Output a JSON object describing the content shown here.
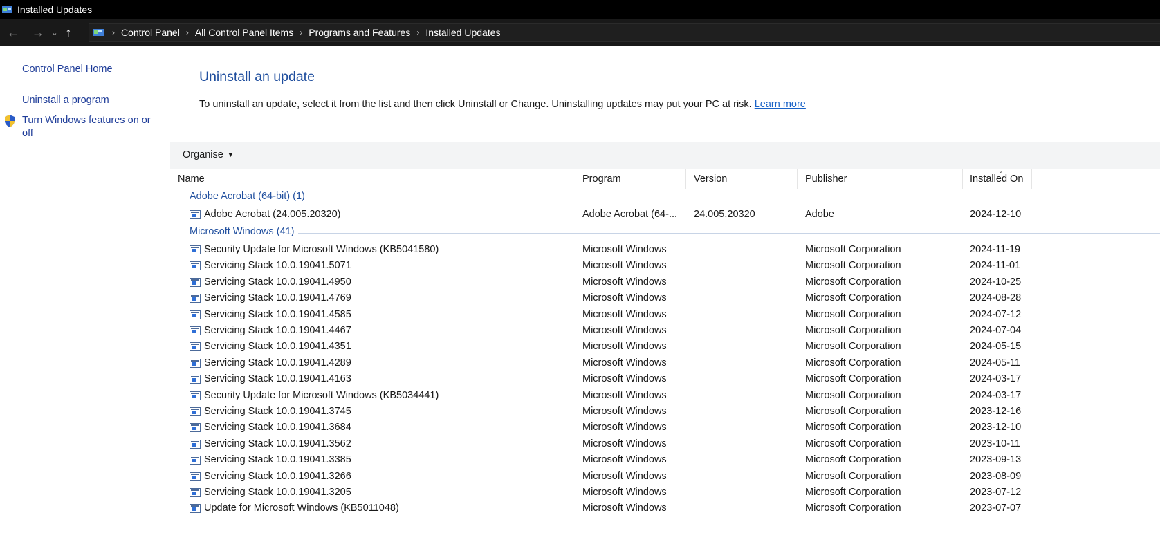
{
  "window": {
    "title": "Installed Updates"
  },
  "breadcrumbs": [
    "Control Panel",
    "All Control Panel Items",
    "Programs and Features",
    "Installed Updates"
  ],
  "sidebar": {
    "home": "Control Panel Home",
    "uninstall_program": "Uninstall a program",
    "windows_features": "Turn Windows features on or off"
  },
  "main": {
    "title": "Uninstall an update",
    "description": "To uninstall an update, select it from the list and then click Uninstall or Change. Uninstalling updates may put your PC at risk.",
    "learn_more": "Learn more",
    "organise": "Organise"
  },
  "columns": [
    "Name",
    "Program",
    "Version",
    "Publisher",
    "Installed On"
  ],
  "groups": [
    {
      "label": "Adobe Acrobat (64-bit) (1)",
      "rows": [
        {
          "name": "Adobe Acrobat (24.005.20320)",
          "program": "Adobe Acrobat (64-...",
          "version": "24.005.20320",
          "publisher": "Adobe",
          "date": "2024-12-10"
        }
      ]
    },
    {
      "label": "Microsoft Windows (41)",
      "rows": [
        {
          "name": "Security Update for Microsoft Windows (KB5041580)",
          "program": "Microsoft Windows",
          "version": "",
          "publisher": "Microsoft Corporation",
          "date": "2024-11-19"
        },
        {
          "name": "Servicing Stack 10.0.19041.5071",
          "program": "Microsoft Windows",
          "version": "",
          "publisher": "Microsoft Corporation",
          "date": "2024-11-01"
        },
        {
          "name": "Servicing Stack 10.0.19041.4950",
          "program": "Microsoft Windows",
          "version": "",
          "publisher": "Microsoft Corporation",
          "date": "2024-10-25"
        },
        {
          "name": "Servicing Stack 10.0.19041.4769",
          "program": "Microsoft Windows",
          "version": "",
          "publisher": "Microsoft Corporation",
          "date": "2024-08-28"
        },
        {
          "name": "Servicing Stack 10.0.19041.4585",
          "program": "Microsoft Windows",
          "version": "",
          "publisher": "Microsoft Corporation",
          "date": "2024-07-12"
        },
        {
          "name": "Servicing Stack 10.0.19041.4467",
          "program": "Microsoft Windows",
          "version": "",
          "publisher": "Microsoft Corporation",
          "date": "2024-07-04"
        },
        {
          "name": "Servicing Stack 10.0.19041.4351",
          "program": "Microsoft Windows",
          "version": "",
          "publisher": "Microsoft Corporation",
          "date": "2024-05-15"
        },
        {
          "name": "Servicing Stack 10.0.19041.4289",
          "program": "Microsoft Windows",
          "version": "",
          "publisher": "Microsoft Corporation",
          "date": "2024-05-11"
        },
        {
          "name": "Servicing Stack 10.0.19041.4163",
          "program": "Microsoft Windows",
          "version": "",
          "publisher": "Microsoft Corporation",
          "date": "2024-03-17"
        },
        {
          "name": "Security Update for Microsoft Windows (KB5034441)",
          "program": "Microsoft Windows",
          "version": "",
          "publisher": "Microsoft Corporation",
          "date": "2024-03-17"
        },
        {
          "name": "Servicing Stack 10.0.19041.3745",
          "program": "Microsoft Windows",
          "version": "",
          "publisher": "Microsoft Corporation",
          "date": "2023-12-16"
        },
        {
          "name": "Servicing Stack 10.0.19041.3684",
          "program": "Microsoft Windows",
          "version": "",
          "publisher": "Microsoft Corporation",
          "date": "2023-12-10"
        },
        {
          "name": "Servicing Stack 10.0.19041.3562",
          "program": "Microsoft Windows",
          "version": "",
          "publisher": "Microsoft Corporation",
          "date": "2023-10-11"
        },
        {
          "name": "Servicing Stack 10.0.19041.3385",
          "program": "Microsoft Windows",
          "version": "",
          "publisher": "Microsoft Corporation",
          "date": "2023-09-13"
        },
        {
          "name": "Servicing Stack 10.0.19041.3266",
          "program": "Microsoft Windows",
          "version": "",
          "publisher": "Microsoft Corporation",
          "date": "2023-08-09"
        },
        {
          "name": "Servicing Stack 10.0.19041.3205",
          "program": "Microsoft Windows",
          "version": "",
          "publisher": "Microsoft Corporation",
          "date": "2023-07-12"
        },
        {
          "name": "Update for Microsoft Windows (KB5011048)",
          "program": "Microsoft Windows",
          "version": "",
          "publisher": "Microsoft Corporation",
          "date": "2023-07-07"
        }
      ]
    }
  ],
  "icons": {
    "window": "control-panel-icon",
    "back": "arrow-left-icon",
    "forward": "arrow-right-icon",
    "recent": "chevron-down-icon",
    "up": "arrow-up-icon",
    "address": "control-panel-icon",
    "features": "uac-shield-icon",
    "row": "update-icon"
  },
  "colors": {
    "link": "#1f3d99",
    "heading": "#1f4e9e",
    "titlebar": "#000000",
    "navbar": "#191919"
  }
}
